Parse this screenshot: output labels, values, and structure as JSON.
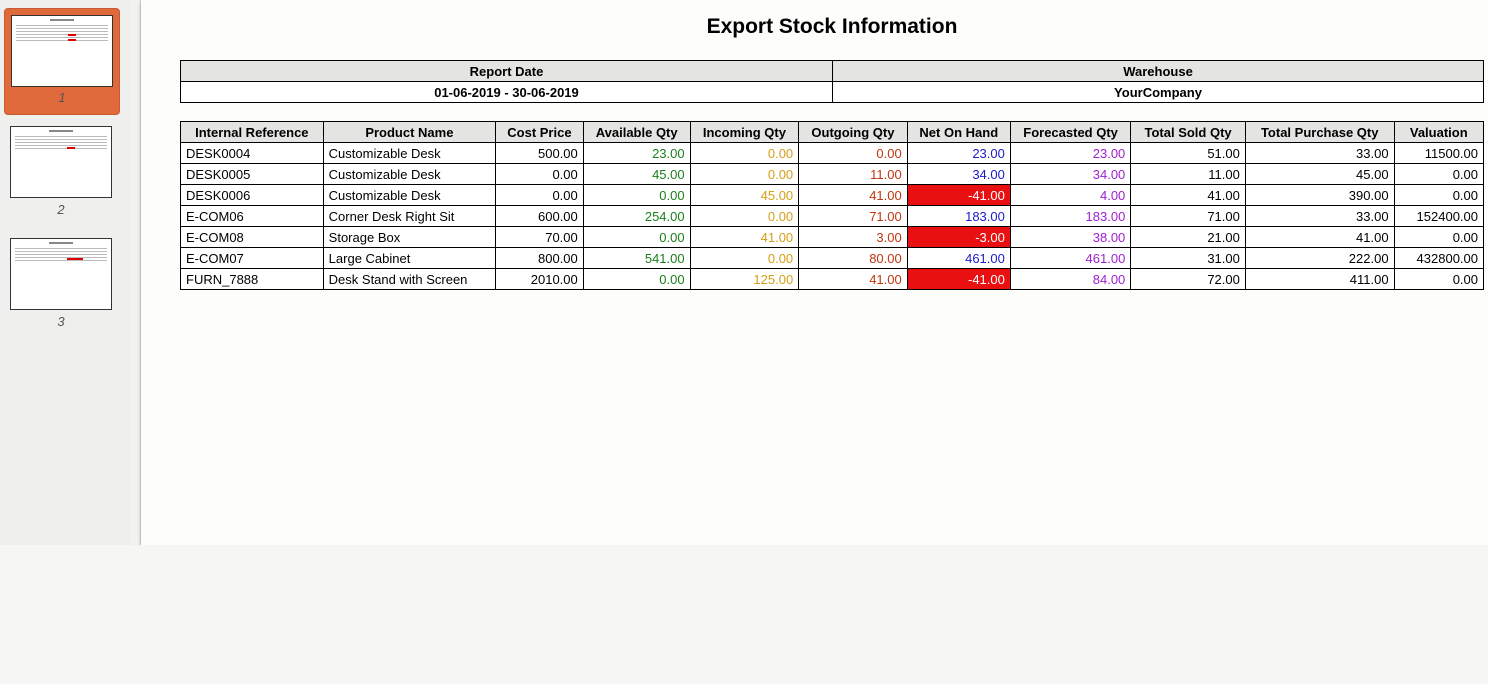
{
  "sidebar": {
    "pages": [
      {
        "label": "1",
        "active": true
      },
      {
        "label": "2",
        "active": false
      },
      {
        "label": "3",
        "active": false
      }
    ]
  },
  "report": {
    "title": "Export Stock Information",
    "header": {
      "report_date_label": "Report Date",
      "warehouse_label": "Warehouse",
      "report_date_value": "01-06-2019 - 30-06-2019",
      "warehouse_value": "YourCompany"
    },
    "columns": [
      "Internal Reference",
      "Product Name",
      "Cost Price",
      "Available Qty",
      "Incoming Qty",
      "Outgoing Qty",
      "Net On Hand",
      "Forecasted Qty",
      "Total Sold Qty",
      "Total Purchase Qty",
      "Valuation"
    ],
    "rows": [
      [
        "DESK0004",
        "Customizable Desk",
        "500.00",
        "23.00",
        "0.00",
        "0.00",
        "23.00",
        "23.00",
        "51.00",
        "33.00",
        "11500.00"
      ],
      [
        "DESK0005",
        "Customizable Desk",
        "0.00",
        "45.00",
        "0.00",
        "11.00",
        "34.00",
        "34.00",
        "11.00",
        "45.00",
        "0.00"
      ],
      [
        "DESK0006",
        "Customizable Desk",
        "0.00",
        "0.00",
        "45.00",
        "41.00",
        "-41.00",
        "4.00",
        "41.00",
        "390.00",
        "0.00"
      ],
      [
        "E-COM06",
        "Corner Desk Right Sit",
        "600.00",
        "254.00",
        "0.00",
        "71.00",
        "183.00",
        "183.00",
        "71.00",
        "33.00",
        "152400.00"
      ],
      [
        "E-COM08",
        "Storage Box",
        "70.00",
        "0.00",
        "41.00",
        "3.00",
        "-3.00",
        "38.00",
        "21.00",
        "41.00",
        "0.00"
      ],
      [
        "E-COM07",
        "Large Cabinet",
        "800.00",
        "541.00",
        "0.00",
        "80.00",
        "461.00",
        "461.00",
        "31.00",
        "222.00",
        "432800.00"
      ],
      [
        "FURN_7888",
        "Desk Stand with Screen",
        "2010.00",
        "0.00",
        "125.00",
        "41.00",
        "-41.00",
        "84.00",
        "72.00",
        "411.00",
        "0.00"
      ]
    ]
  },
  "colors": {
    "active_thumb": "#e06a3c",
    "available": "#1a7f1a",
    "incoming": "#d4a017",
    "outgoing": "#c0360f",
    "net_on_hand": "#1a1ad0",
    "negative_bg": "#e81010",
    "forecasted": "#a020d0"
  }
}
